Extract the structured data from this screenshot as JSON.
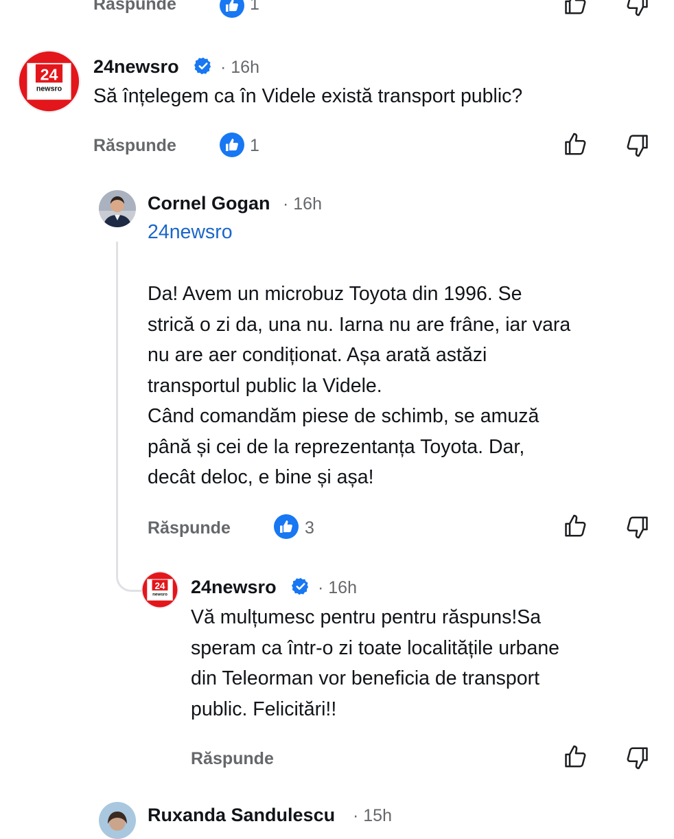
{
  "top_row": {
    "reply_label": "Răspunde",
    "like_count": "1"
  },
  "comment1": {
    "author": "24newsro",
    "time": "· 16h",
    "text": "Să înțelegem ca în Videle există transport public?",
    "reply_label": "Răspunde",
    "like_count": "1"
  },
  "comment2": {
    "author": "Cornel Gogan",
    "time": "· 16h",
    "mention": "24newsro",
    "lines": [
      "Da! Avem un microbuz Toyota din 1996. Se",
      "strică o zi da, una nu. Iarna nu are frâne, iar vara",
      "nu are aer condiționat. Așa arată astăzi",
      "transportul public la Videle.",
      "Când comandăm piese de schimb, se amuză",
      "până și cei de la reprezentanța Toyota. Dar,",
      "decât deloc, e bine și așa!"
    ],
    "reply_label": "Răspunde",
    "like_count": "3"
  },
  "comment3": {
    "author": "24newsro",
    "time": "· 16h",
    "lines": [
      "Vă mulțumesc pentru pentru răspuns!Sa",
      "speram ca într-o zi toate localitățile urbane",
      "din Teleorman vor beneficia de transport",
      "public. Felicitări!!"
    ],
    "reply_label": "Răspunde"
  },
  "comment4": {
    "author": "Ruxanda Sandulescu",
    "time": "· 15h"
  },
  "logo": {
    "number": "24",
    "word": "newsro"
  },
  "colors": {
    "like_blue": "#1877f2",
    "verified_blue": "#1877f2",
    "mention_blue": "#1b66c9",
    "logo_red": "#e3161b"
  }
}
